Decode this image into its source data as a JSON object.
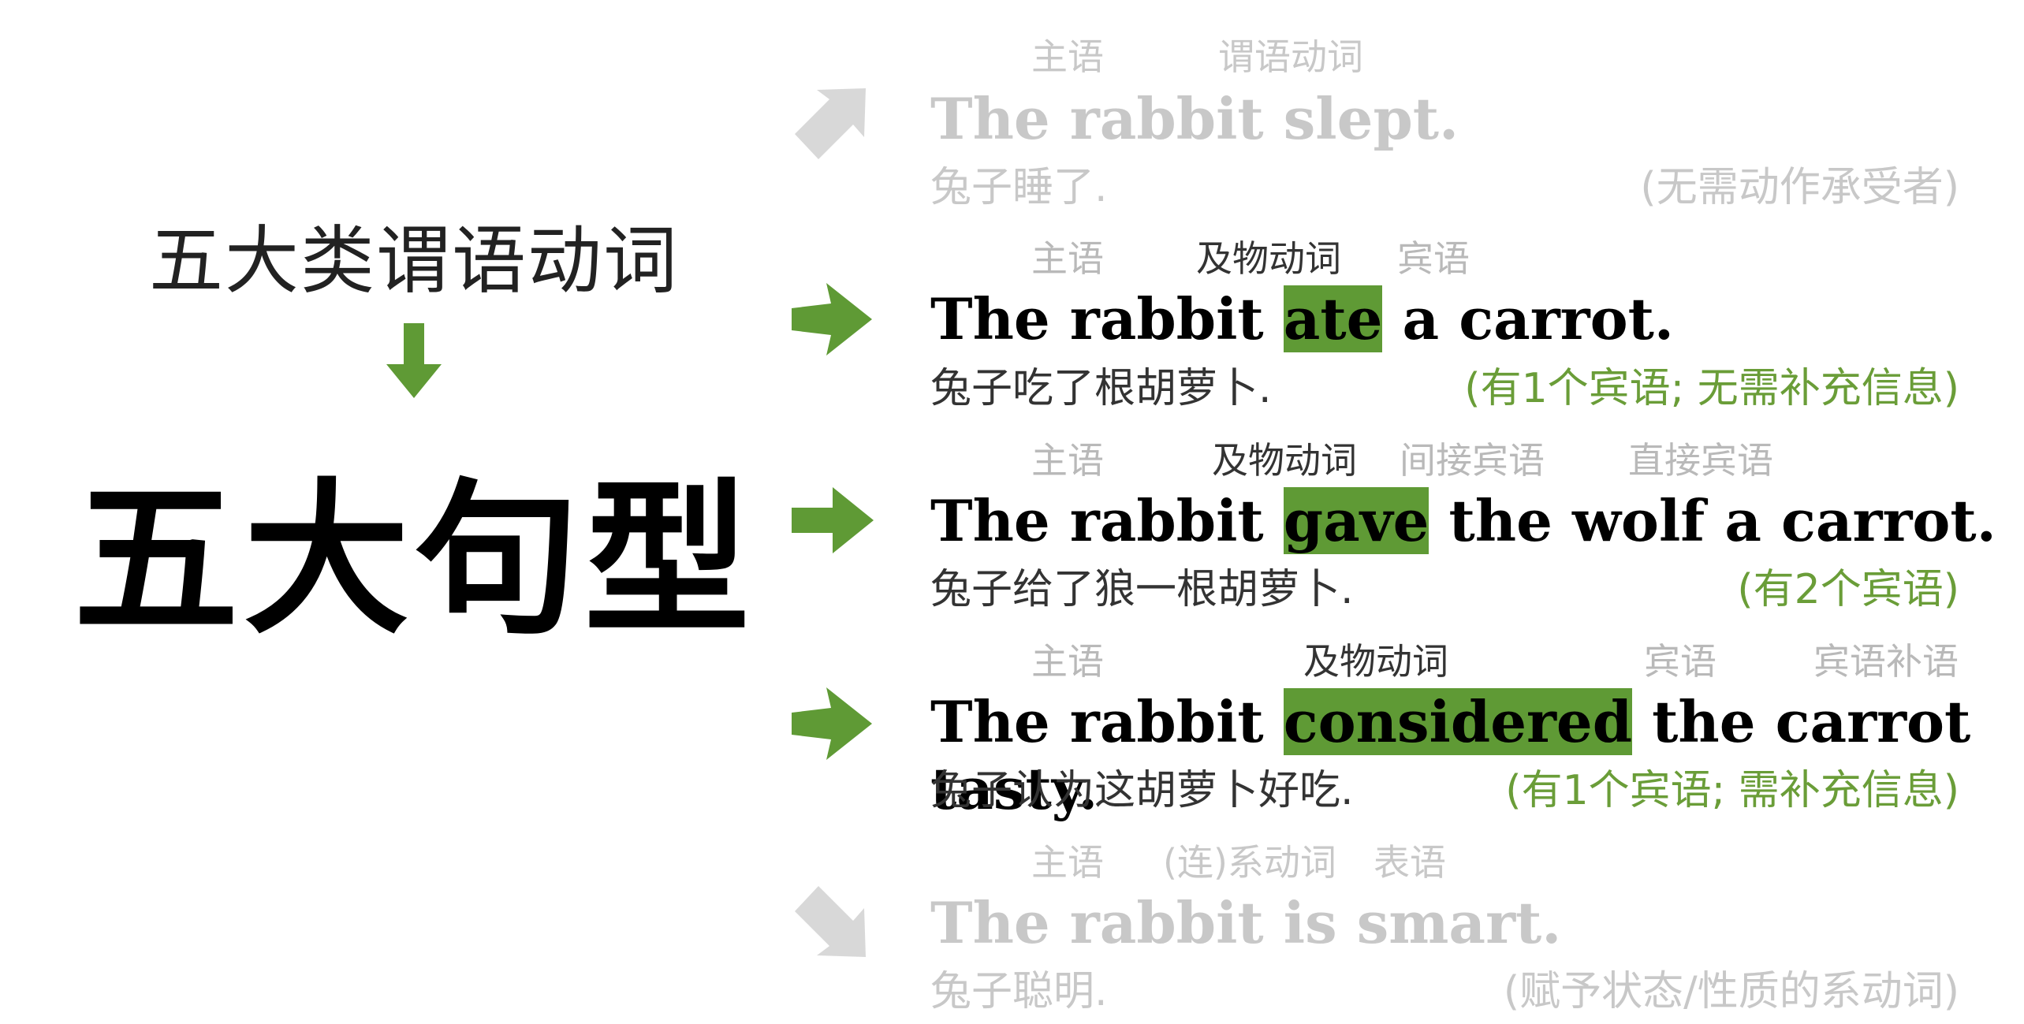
{
  "left": {
    "subtitle": "五大类谓语动词",
    "title": "五大句型"
  },
  "rows": [
    {
      "labels": [
        "主语",
        "谓语动词"
      ],
      "sentence": {
        "before": "The rabbit slept.",
        "verb": "",
        "after": ""
      },
      "translation": "兔子睡了.",
      "note": "(无需动作承受者)"
    },
    {
      "labels": [
        "主语",
        "及物动词",
        "宾语"
      ],
      "sentence": {
        "before": "The rabbit ",
        "verb": "ate",
        "after": " a carrot."
      },
      "translation": "兔子吃了根胡萝卜.",
      "note": "(有1个宾语; 无需补充信息)"
    },
    {
      "labels": [
        "主语",
        "及物动词",
        "间接宾语",
        "直接宾语"
      ],
      "sentence": {
        "before": "The rabbit ",
        "verb": "gave",
        "after": " the wolf a carrot."
      },
      "translation": "兔子给了狼一根胡萝卜.",
      "note": "(有2个宾语)"
    },
    {
      "labels": [
        "主语",
        "及物动词",
        "宾语",
        "宾语补语"
      ],
      "sentence": {
        "before": "The rabbit ",
        "verb": "considered",
        "after": " the carrot tasty."
      },
      "translation": "兔子认为这胡萝卜好吃.",
      "note": "(有1个宾语; 需补充信息)"
    },
    {
      "labels": [
        "主语",
        "(连)系动词",
        "表语"
      ],
      "sentence": {
        "before": "The rabbit is smart.",
        "verb": "",
        "after": ""
      },
      "translation": "兔子聪明.",
      "note": "(赋予状态/性质的系动词)"
    }
  ],
  "colors": {
    "accent": "#5f9a35",
    "note": "#6a9d38",
    "faded": "#c8c8c8"
  },
  "icons": [
    "arrow-down-icon",
    "arrow-up-right-icon",
    "arrow-right-icon",
    "arrow-down-right-icon"
  ]
}
